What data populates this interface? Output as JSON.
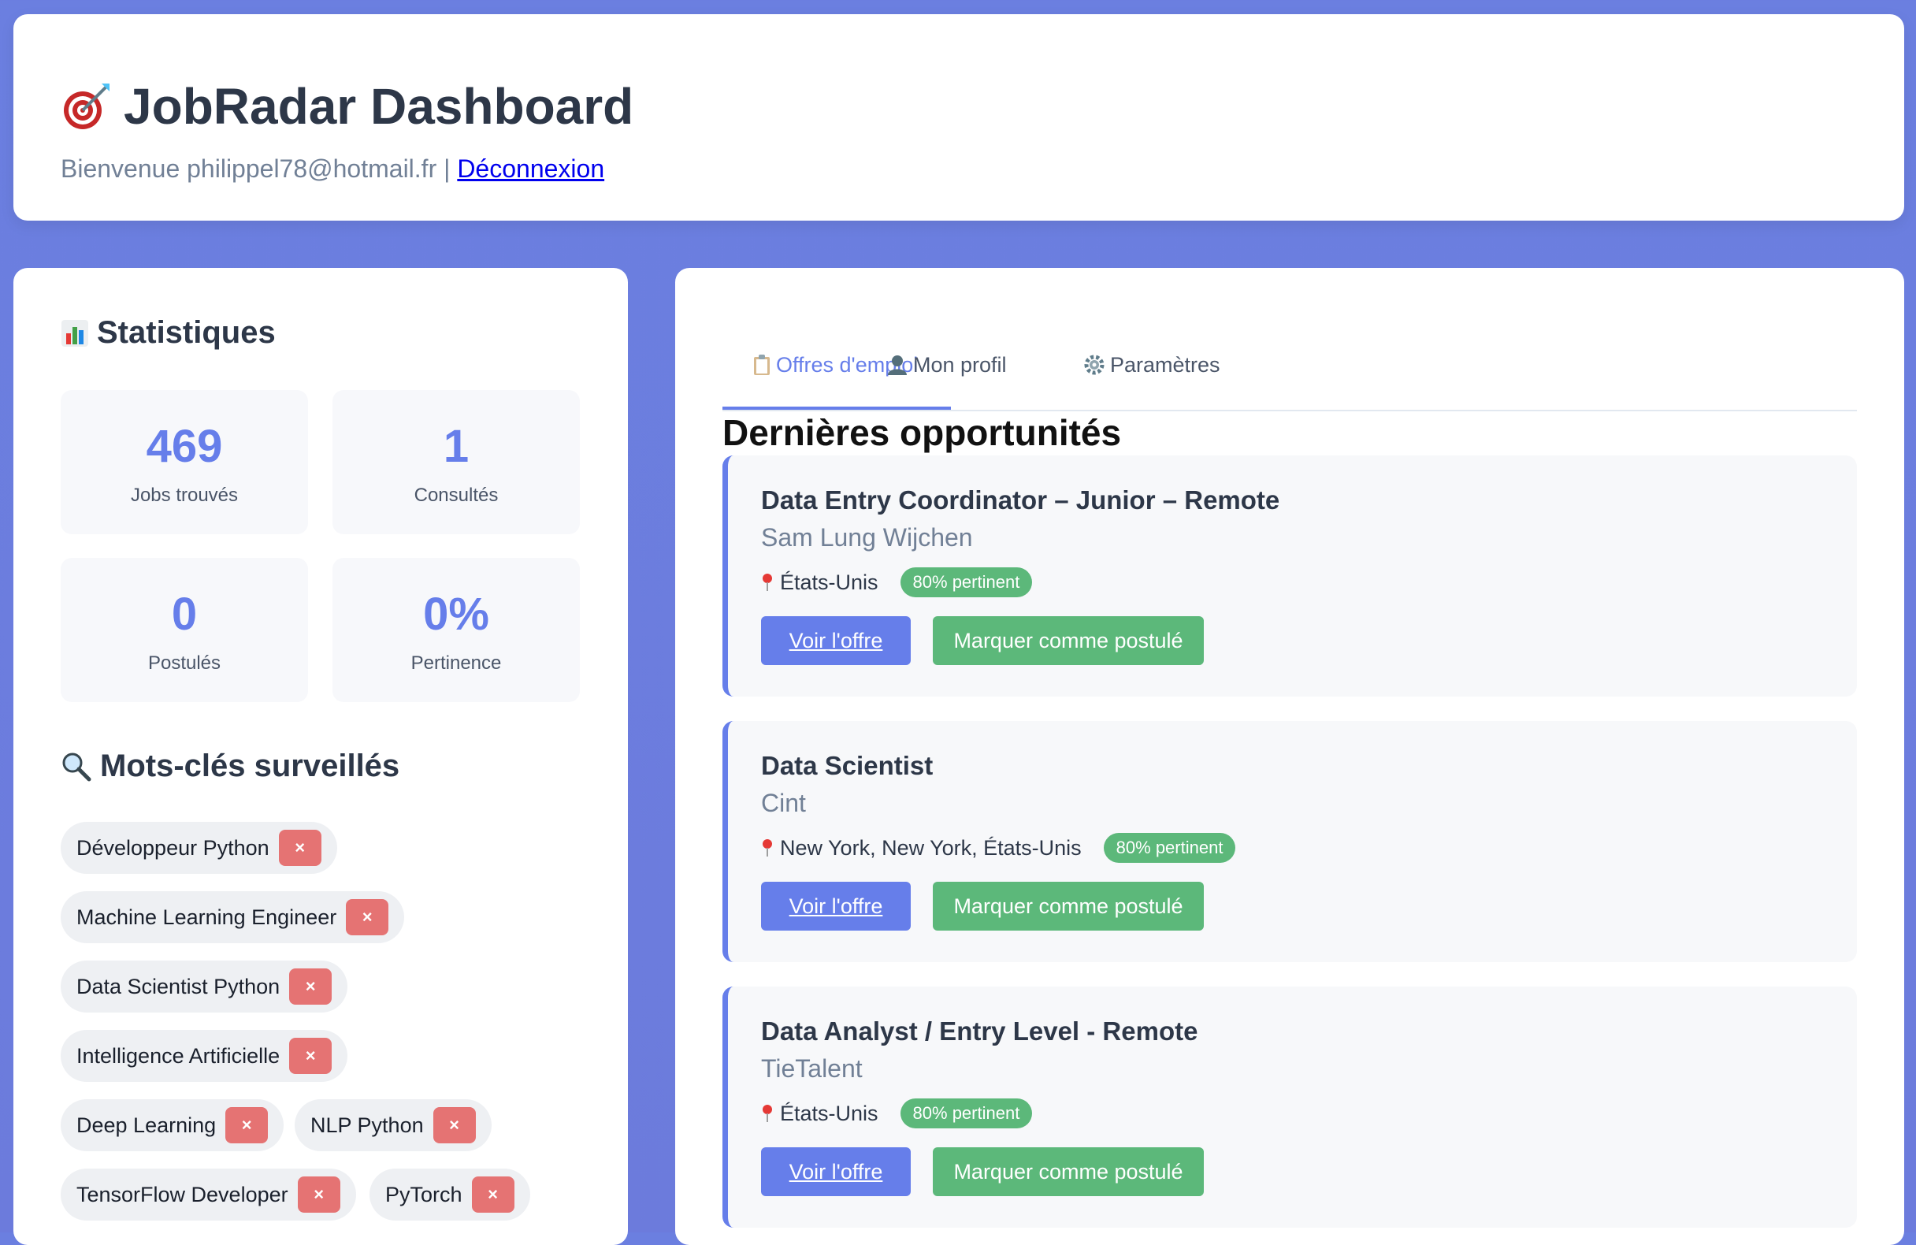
{
  "header": {
    "title": "JobRadar Dashboard",
    "title_icon": "target-icon",
    "welcome_text": "Bienvenue philippel78@hotmail.fr |",
    "logout_label": "Déconnexion"
  },
  "stats": {
    "section_title": "Statistiques",
    "section_icon": "bar-chart-icon",
    "cards": [
      {
        "value": "469",
        "label": "Jobs trouvés"
      },
      {
        "value": "1",
        "label": "Consultés"
      },
      {
        "value": "0",
        "label": "Postulés"
      },
      {
        "value": "0%",
        "label": "Pertinence"
      }
    ]
  },
  "keywords": {
    "section_title": "Mots-clés surveillés",
    "section_icon": "magnifier-icon",
    "remove_label": "×",
    "items": [
      "Développeur Python",
      "Machine Learning Engineer",
      "Data Scientist Python",
      "Intelligence Artificielle",
      "Deep Learning",
      "NLP Python",
      "TensorFlow Developer",
      "PyTorch"
    ]
  },
  "tabs": [
    {
      "label": "Offres d'emploi",
      "icon": "clipboard-icon",
      "active": true
    },
    {
      "label": "Mon profil",
      "icon": "user-icon",
      "active": false
    },
    {
      "label": "Paramètres",
      "icon": "gear-icon",
      "active": false
    }
  ],
  "jobs": {
    "title": "Dernières opportunités",
    "view_label": "Voir l'offre",
    "applied_label": "Marquer comme postulé",
    "items": [
      {
        "title": "Data Entry Coordinator – Junior – Remote",
        "company": "Sam Lung Wijchen",
        "location": "États-Unis",
        "badge": "80% pertinent"
      },
      {
        "title": "Data Scientist",
        "company": "Cint",
        "location": "New York, New York, États-Unis",
        "badge": "80% pertinent"
      },
      {
        "title": "Data Analyst / Entry Level - Remote",
        "company": "TieTalent",
        "location": "États-Unis",
        "badge": "80% pertinent"
      }
    ]
  },
  "colors": {
    "accent": "#667eea",
    "success": "#5cb87a",
    "danger": "#e57373",
    "background": "#6b7fe0"
  }
}
